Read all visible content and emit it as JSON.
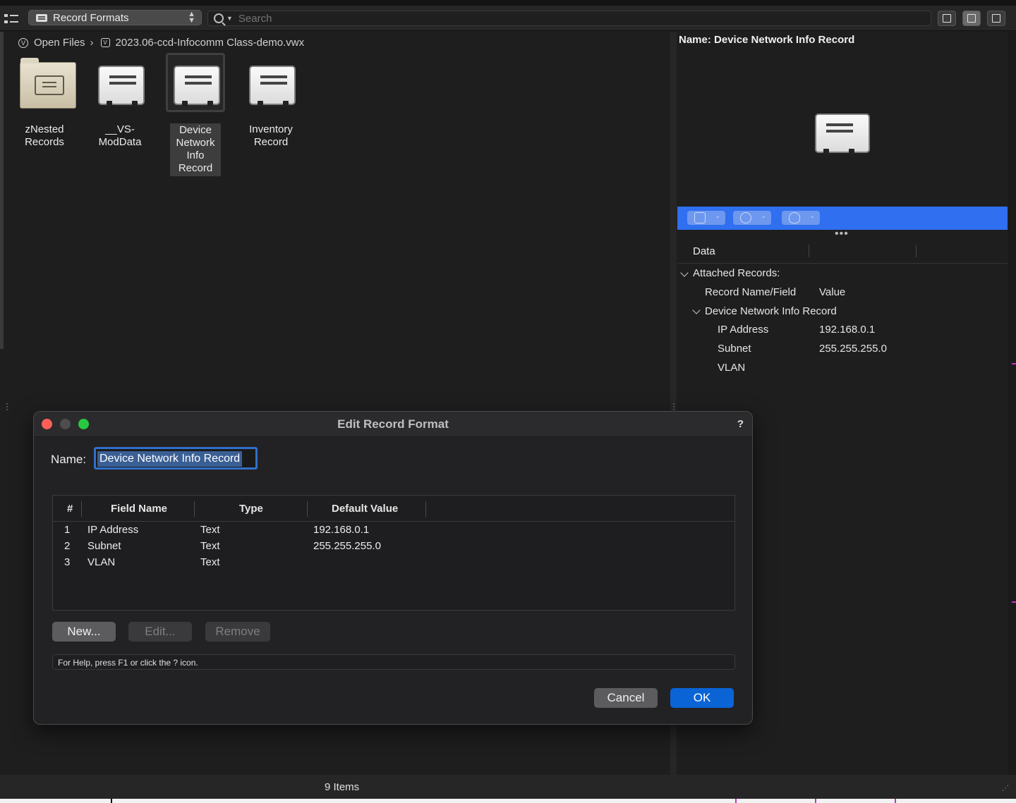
{
  "toolbar": {
    "resource_type": "Record Formats",
    "search_placeholder": "Search"
  },
  "breadcrumb": {
    "root": "Open Files",
    "file": "2023.06-ccd-Infocomm Class-demo.vwx"
  },
  "resources": [
    {
      "label": "zNested Records",
      "kind": "folder",
      "selected": false
    },
    {
      "label": "__VS-ModData",
      "kind": "record",
      "selected": false
    },
    {
      "label": "Device Network Info Record",
      "kind": "record",
      "selected": true
    },
    {
      "label": "Inventory Record",
      "kind": "record",
      "selected": false
    }
  ],
  "right_panel": {
    "title": "Name: Device Network Info Record",
    "data_tab": "Data",
    "attached_records": "Attached Records:",
    "col_name": "Record Name/Field",
    "col_value": "Value",
    "record_name": "Device Network Info Record",
    "fields": [
      {
        "name": "IP Address",
        "value": "192.168.0.1"
      },
      {
        "name": "Subnet",
        "value": "255.255.255.0"
      },
      {
        "name": "VLAN",
        "value": ""
      }
    ]
  },
  "status": {
    "items": "9 Items"
  },
  "dialog": {
    "title": "Edit Record Format",
    "help_icon": "?",
    "name_label": "Name:",
    "name_value": "Device Network Info Record",
    "columns": [
      "#",
      "Field Name",
      "Type",
      "Default Value"
    ],
    "rows": [
      {
        "num": "1",
        "field": "IP Address",
        "type": "Text",
        "default": "192.168.0.1"
      },
      {
        "num": "2",
        "field": "Subnet",
        "type": "Text",
        "default": "255.255.255.0"
      },
      {
        "num": "3",
        "field": "VLAN",
        "type": "Text",
        "default": ""
      }
    ],
    "new_button": "New...",
    "edit_button": "Edit...",
    "remove_button": "Remove",
    "help_text": "For Help, press F1 or click the ? icon.",
    "cancel_button": "Cancel",
    "ok_button": "OK"
  },
  "colors": {
    "accent": "#2f6ff0",
    "ok_button": "#0a64d6",
    "close_light": "#ff5f57",
    "zoom_light": "#28c840"
  }
}
